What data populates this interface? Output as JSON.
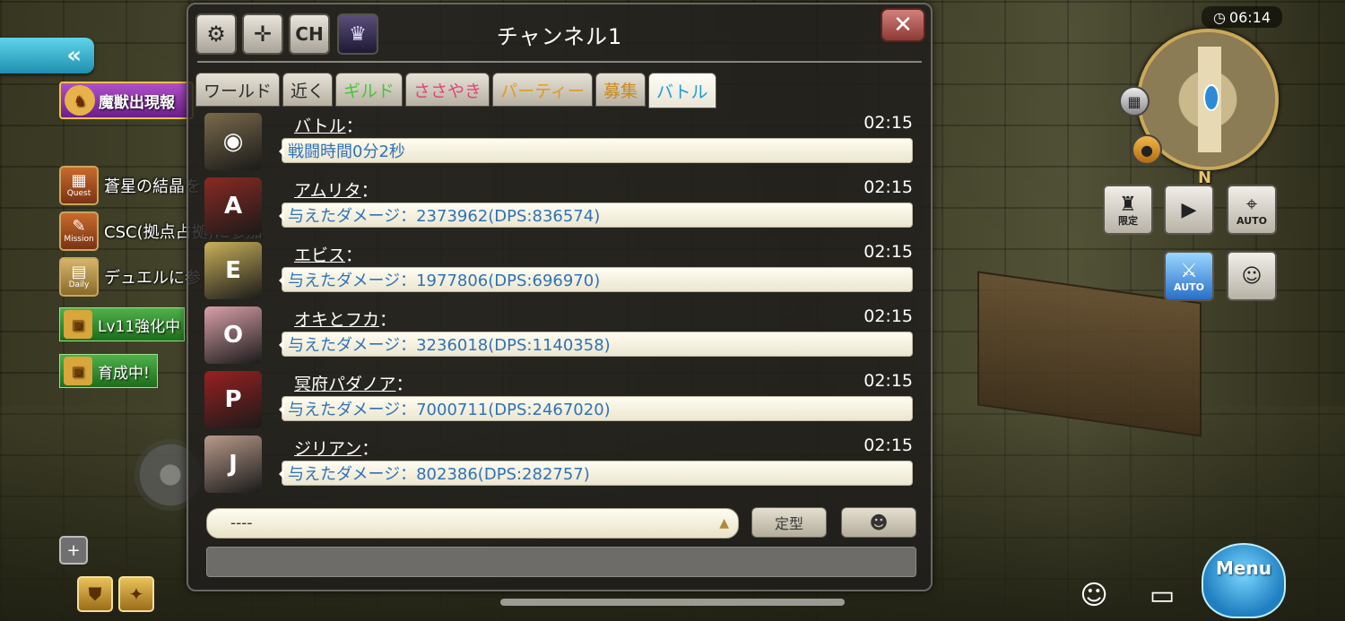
{
  "left_hud": {
    "back_arrow": "«",
    "beast_banner": "魔獣出現報",
    "quest": {
      "icon_label": "Quest",
      "text": "蒼星の結晶を"
    },
    "mission": {
      "icon_label": "Mission",
      "text": "CSC(拠点占拠)に参加"
    },
    "daily": {
      "icon_label": "Daily",
      "text": "デュエルに参"
    },
    "green_tags": [
      "Lv11強化中",
      "育成中!"
    ]
  },
  "chat": {
    "title": "チャンネル1",
    "toolbar": {
      "ch_label": "CH"
    },
    "tabs": [
      "ワールド",
      "近く",
      "ギルド",
      "ささやき",
      "パーティー",
      "募集",
      "バトル"
    ],
    "active_tab": "バトル",
    "messages": [
      {
        "name": "バトル",
        "time": "02:15",
        "text": "戦闘時間0分2秒",
        "portrait_color": "#7a6a4a",
        "portrait_glyph": "◉"
      },
      {
        "name": "アムリタ",
        "time": "02:15",
        "text": "与えたダメージ：2373962(DPS:836574)",
        "portrait_color": "#8a2a22",
        "portrait_glyph": "A"
      },
      {
        "name": "エビス",
        "time": "02:15",
        "text": "与えたダメージ：1977806(DPS:696970)",
        "portrait_color": "#c9b05a",
        "portrait_glyph": "E"
      },
      {
        "name": "オキとフカ",
        "time": "02:15",
        "text": "与えたダメージ：3236018(DPS:1140358)",
        "portrait_color": "#d9a0a8",
        "portrait_glyph": "O"
      },
      {
        "name": "冥府パダノア",
        "time": "02:15",
        "text": "与えたダメージ：7000711(DPS:2467020)",
        "portrait_color": "#9a2020",
        "portrait_glyph": "P"
      },
      {
        "name": "ジリアン",
        "time": "02:15",
        "text": "与えたダメージ：802386(DPS:282757)",
        "portrait_color": "#b89a8a",
        "portrait_glyph": "J"
      }
    ],
    "input_value": "----",
    "preset_label": "定型"
  },
  "right_hud": {
    "clock": "06:14",
    "compass": "N",
    "buttons": {
      "limited": "限定",
      "auto": "AUTO",
      "auto2": "AUTO"
    },
    "menu_label": "Menu"
  },
  "colors": {
    "battle_tab": "#1e9bd8",
    "guild_tab": "#4ac23a",
    "whisper_tab": "#e0457a",
    "party_tab": "#e09a1c",
    "bubble_text": "#2f72b8"
  }
}
